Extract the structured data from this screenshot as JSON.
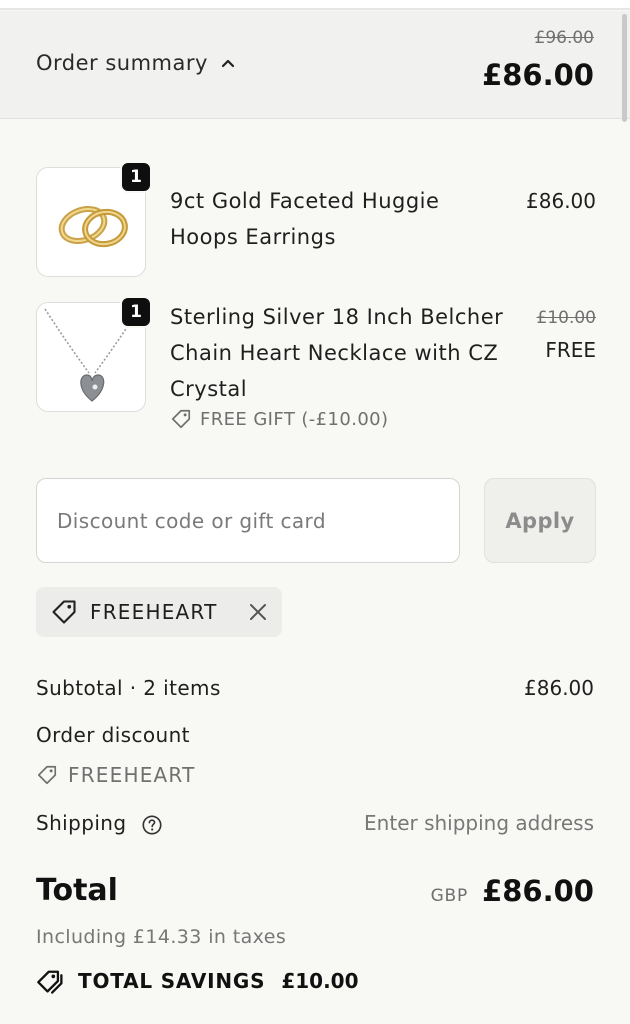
{
  "summary": {
    "toggle_label": "Order summary",
    "original_total": "£96.00",
    "total": "£86.00"
  },
  "items": [
    {
      "title": "9ct Gold Faceted Huggie Hoops Earrings",
      "quantity": "1",
      "price": "£86.00",
      "image_icon": "gold-hoop-earrings-image"
    },
    {
      "title": "Sterling Silver 18 Inch Belcher Chain Heart Necklace with CZ Crystal",
      "quantity": "1",
      "original_price": "£10.00",
      "price": "FREE",
      "gift_label": "FREE GIFT (-£10.00)",
      "image_icon": "silver-heart-necklace-image"
    }
  ],
  "discount": {
    "placeholder": "Discount code or gift card",
    "apply_label": "Apply",
    "applied_code": "FREEHEART"
  },
  "totals": {
    "subtotal_label": "Subtotal · 2 items",
    "subtotal_value": "£86.00",
    "order_discount_label": "Order discount",
    "order_discount_code": "FREEHEART",
    "shipping_label": "Shipping",
    "shipping_value": "Enter shipping address",
    "total_label": "Total",
    "currency": "GBP",
    "total_value": "£86.00",
    "tax_note": "Including £14.33 in taxes",
    "savings_label": "TOTAL SAVINGS",
    "savings_value": "£10.00"
  },
  "icons": {
    "toggle": "chevron-up-icon",
    "tag": "tag-icon",
    "remove": "close-icon",
    "help": "question-circle-icon",
    "savings": "tags-icon"
  }
}
